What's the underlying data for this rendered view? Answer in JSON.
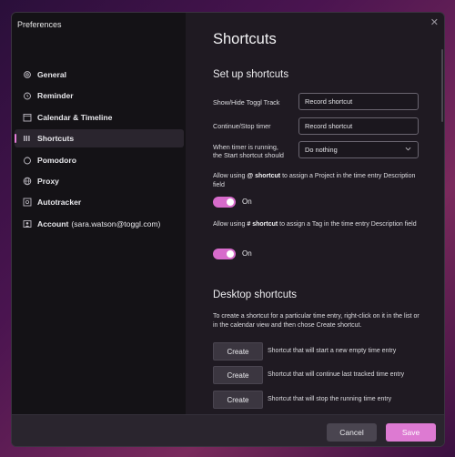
{
  "window": {
    "title": "Preferences"
  },
  "sidebar": {
    "items": [
      {
        "label": "General",
        "icon": "gear-icon"
      },
      {
        "label": "Reminder",
        "icon": "alarm-clock-icon"
      },
      {
        "label": "Calendar & Timeline",
        "icon": "calendar-icon"
      },
      {
        "label": "Shortcuts",
        "icon": "shortcuts-bar-icon",
        "active": true
      },
      {
        "label": "Pomodoro",
        "icon": "pomodoro-icon"
      },
      {
        "label": "Proxy",
        "icon": "globe-icon"
      },
      {
        "label": "Autotracker",
        "icon": "target-icon"
      },
      {
        "label": "Account",
        "suffix": "(sara.watson@toggl.com)",
        "icon": "account-icon"
      }
    ]
  },
  "main": {
    "title": "Shortcuts",
    "setup": {
      "title": "Set up shortcuts",
      "show_hide_label": "Show/Hide Toggl Track",
      "show_hide_value": "Record shortcut",
      "continue_stop_label": "Continue/Stop timer",
      "continue_stop_value": "Record shortcut",
      "timer_running_label_1": "When timer is running,",
      "timer_running_label_2": "the Start shortcut should",
      "timer_running_value": "Do nothing",
      "project_desc_pre": "Allow using ",
      "project_desc_bold": "@ shortcut",
      "project_desc_post": " to assign a Project in the time entry Description field",
      "project_toggle": "On",
      "tag_desc_pre": "Allow using ",
      "tag_desc_bold": "# shortcut",
      "tag_desc_post": " to assign a Tag in the time entry Description field",
      "tag_toggle": "On"
    },
    "desktop": {
      "title": "Desktop shortcuts",
      "description": "To create a shortcut for a particular time entry, right-click on it in the list or in the calendar view and then chose Create shortcut.",
      "buttons": [
        {
          "label": "Create",
          "desc": "Shortcut that will start a new empty time entry"
        },
        {
          "label": "Create",
          "desc": "Shortcut that will continue last tracked time entry"
        },
        {
          "label": "Create",
          "desc": "Shortcut that will stop the running time entry"
        }
      ]
    }
  },
  "footer": {
    "cancel": "Cancel",
    "save": "Save"
  },
  "colors": {
    "accent": "#dd7ad2",
    "sidebar_bg": "#141216",
    "content_bg": "#1f1a22"
  }
}
